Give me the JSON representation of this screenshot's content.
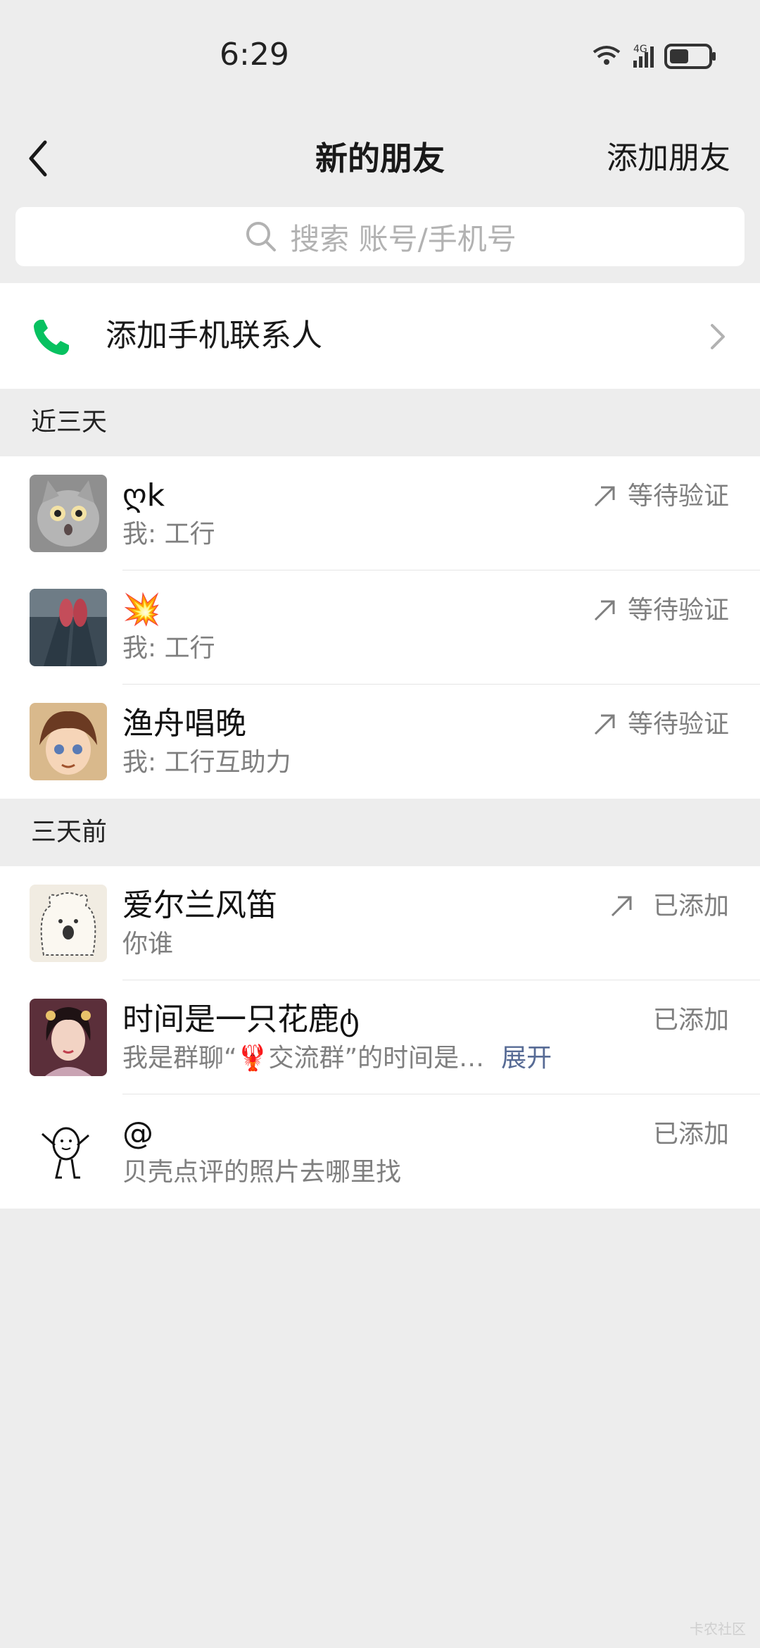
{
  "status_bar": {
    "time": "6:29",
    "network": "4G"
  },
  "nav": {
    "title": "新的朋友",
    "action": "添加朋友"
  },
  "search": {
    "placeholder": "搜索 账号/手机号"
  },
  "phone_contacts": {
    "label": "添加手机联系人",
    "icon": "phone-icon",
    "color": "#07c160"
  },
  "sections": [
    {
      "header": "近三天",
      "items": [
        {
          "name": "ღk",
          "message": "我: 工行",
          "status": "等待验证",
          "arrow": true
        },
        {
          "name": "💥",
          "message": "我: 工行",
          "status": "等待验证",
          "arrow": true
        },
        {
          "name": "渔舟唱晚",
          "message": "我: 工行互助力",
          "status": "等待验证",
          "arrow": true
        }
      ]
    },
    {
      "header": "三天前",
      "items": [
        {
          "name": "爱尔兰风笛",
          "message": "你谁",
          "status": "已添加",
          "arrow": true
        },
        {
          "name": "时间是一只花鹿ტ",
          "message": "我是群聊“🦞交流群”的时间是…",
          "expand": "展开",
          "status": "已添加",
          "arrow": false
        },
        {
          "name": "@",
          "message": "贝壳点评的照片去哪里找",
          "status": "已添加",
          "arrow": false
        }
      ]
    }
  ],
  "watermark": "卡农社区",
  "colors": {
    "background": "#ededed",
    "link": "#576b95",
    "secondary_text": "#7f7f7f"
  }
}
